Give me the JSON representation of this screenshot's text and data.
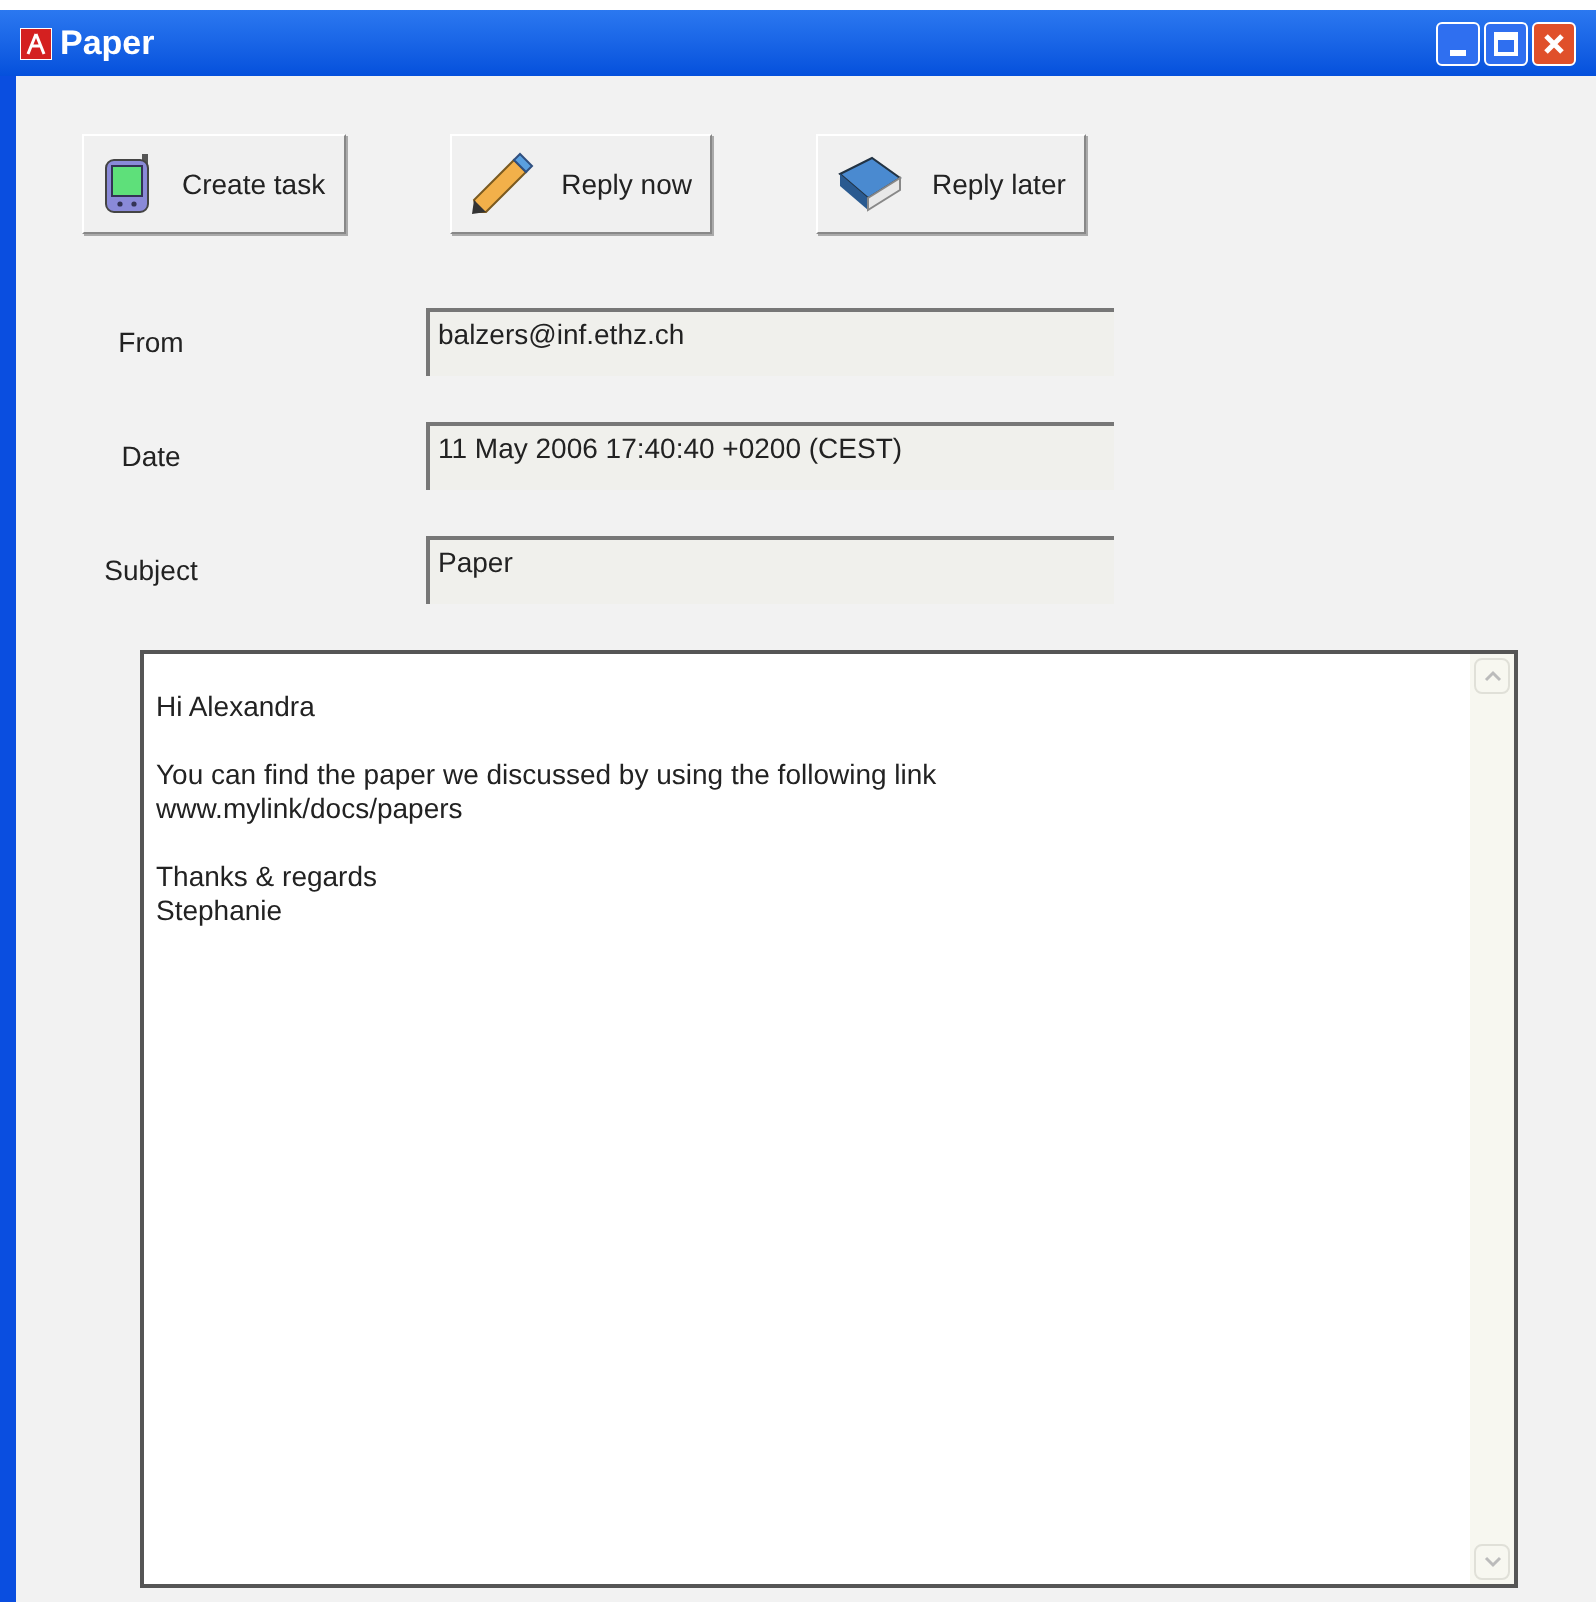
{
  "window": {
    "title": "Paper"
  },
  "toolbar": [
    {
      "label": "Create task",
      "kind": "pda"
    },
    {
      "label": "Reply now",
      "kind": "pencil"
    },
    {
      "label": "Reply later",
      "kind": "book"
    }
  ],
  "fields": [
    {
      "label": "From",
      "value": "balzers@inf.ethz.ch"
    },
    {
      "label": "Date",
      "value": "11 May 2006 17:40:40 +0200 (CEST)"
    },
    {
      "label": "Subject",
      "value": "Paper"
    }
  ],
  "message": {
    "paragraphs": [
      [
        "Hi Alexandra"
      ],
      [
        "You can find the paper we discussed by using the following link",
        "www.mylink/docs/papers"
      ],
      [
        "Thanks & regards",
        "Stephanie"
      ]
    ]
  }
}
